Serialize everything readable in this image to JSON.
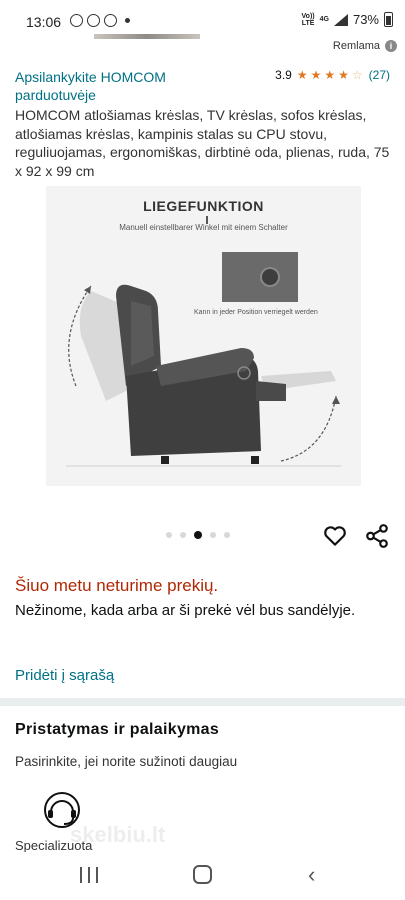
{
  "status_bar": {
    "time": "13:06",
    "battery": "73%",
    "network": [
      "Vo))",
      "LTE",
      "4G"
    ]
  },
  "ad": {
    "label": "Remlama",
    "info_icon": "info-icon"
  },
  "product": {
    "store_link": "Apsilankykite HOMCOM parduotuvėje",
    "rating_value": "3.9",
    "rating_count": "(27)",
    "stars": 3.9,
    "title": "HOMCOM atlošiamas krėslas, TV krėslas, sofos krėslas, atlošiamas krėslas, kampinis stalas su CPU stovu, reguliuojamas, ergonomiškas, dirbtinė oda, plienas, ruda, 75 x 92 x 99 cm"
  },
  "image": {
    "heading": "LIEGEFUNKTION",
    "subtitle": "Manuell einstellbarer Winkel mit einem Schalter",
    "note": "Kann in jeder Position verriegelt werden",
    "carousel_count": 5,
    "carousel_active": 3
  },
  "availability": {
    "status": "Šiuo metu neturime prekių.",
    "description": "Nežinome, kada arba ar ši prekė vėl bus sandėlyje."
  },
  "actions": {
    "add_to_list": "Pridėti į sąrašą",
    "heart_icon": "heart-icon",
    "share_icon": "share-icon"
  },
  "delivery": {
    "title": "Pristatymas ir palaikymas",
    "subtitle": "Pasirinkite, jei norite sužinoti daugiau",
    "option_label": "Specializuota",
    "option_icon": "headset-icon"
  },
  "watermark": "skelbiu.lt",
  "colors": {
    "link": "#007185",
    "price_red": "#b12704",
    "star": "#de7921"
  }
}
